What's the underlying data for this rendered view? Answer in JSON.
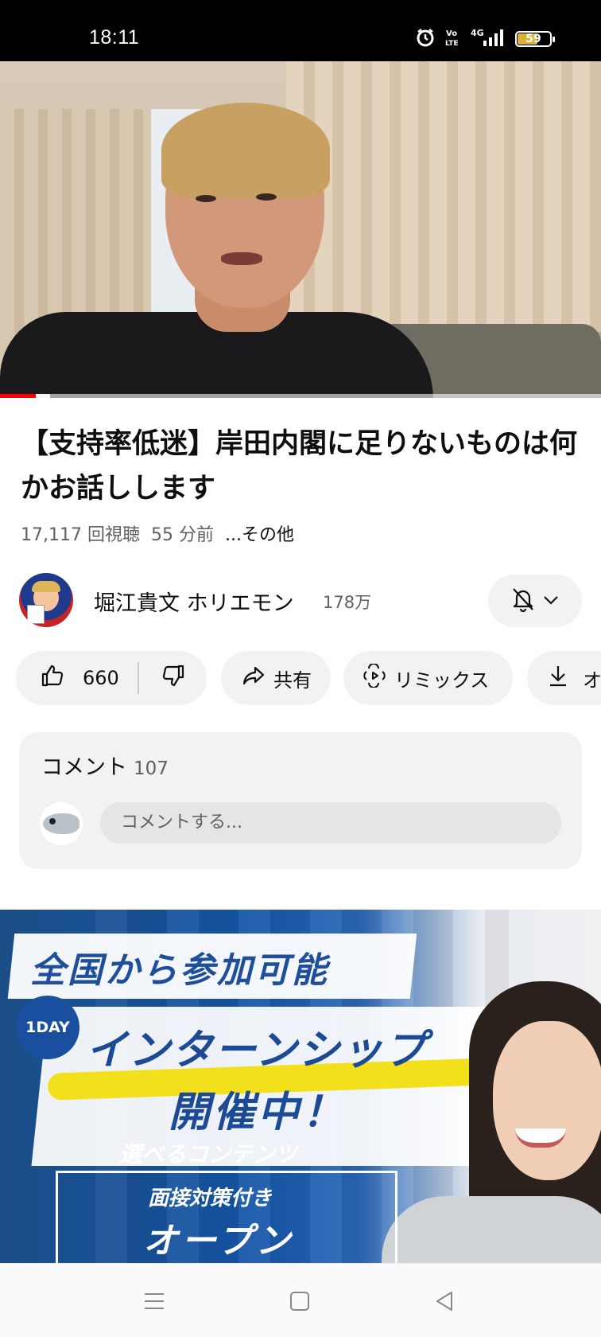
{
  "status_bar": {
    "time": "18:11",
    "icons": [
      "alarm-icon",
      "volte-icon",
      "4g-signal-icon",
      "battery-icon"
    ],
    "network": "4G",
    "battery_level": "59"
  },
  "video": {
    "progress_fraction": 0.06,
    "title": "【支持率低迷】岸田内閣に足りないものは何かお話しします",
    "views": "17,117 回視聴",
    "time_ago": "55 分前",
    "more_label": "...その他"
  },
  "channel": {
    "name": "堀江貴文 ホリエモン",
    "subscribers": "178万",
    "bell_icon": "bell-off-icon"
  },
  "actions": {
    "like_count": "660",
    "share_label": "共有",
    "remix_label": "リミックス",
    "download_label": "オ"
  },
  "comments": {
    "heading": "コメント",
    "count": "107",
    "placeholder": "コメントする..."
  },
  "ad": {
    "line1": "全国から参加可能",
    "badge": "1DAY",
    "line2": "インターンシップ",
    "line3": "開催中！",
    "line4": "選べるコンテンツ",
    "line5": "面接対策付き",
    "line6": "オープン",
    "colors": {
      "blue": "#1c4a95",
      "yellow": "#f3e01c"
    }
  },
  "nav": {
    "icons": [
      "menu-icon",
      "home-square-icon",
      "back-triangle-icon"
    ]
  },
  "colors": {
    "accent_red": "#ff0000",
    "pill_bg": "#f2f2f2",
    "secondary_text": "#606060"
  }
}
